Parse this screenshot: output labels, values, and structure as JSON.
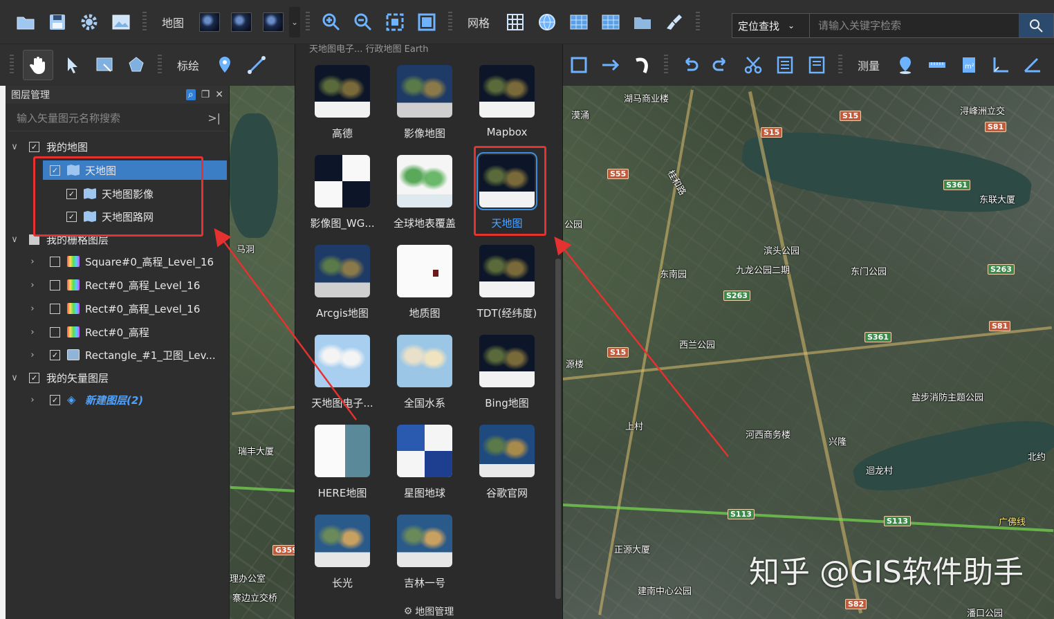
{
  "toolbar_top": {
    "map_label": "地图",
    "grid_label": "网格",
    "search_scope": "定位查找",
    "search_placeholder": "请输入关键字检索"
  },
  "toolbar_second": {
    "plot_label": "标绘",
    "measure_label": "测量"
  },
  "layer_panel": {
    "title": "图层管理",
    "search_placeholder": "输入矢量图元名称搜索",
    "rows": [
      {
        "label": "我的地图"
      },
      {
        "label": "天地图"
      },
      {
        "label": "天地图影像"
      },
      {
        "label": "天地图路网"
      },
      {
        "label": "我的栅格图层"
      },
      {
        "label": "Square#0_高程_Level_16"
      },
      {
        "label": "Rect#0_高程_Level_16"
      },
      {
        "label": "Rect#0_高程_Level_16"
      },
      {
        "label": "Rect#0_高程"
      },
      {
        "label": "Rectangle_#1_卫图_Lev..."
      },
      {
        "label": "我的矢量图层"
      },
      {
        "label": "新建图层(2)"
      }
    ]
  },
  "basemap_panel": {
    "cut_text": "天地图电子...      行政地图       Earth",
    "items": [
      {
        "name": "高德"
      },
      {
        "name": "影像地图"
      },
      {
        "name": "Mapbox"
      },
      {
        "name": "影像图_WG..."
      },
      {
        "name": "全球地表覆盖"
      },
      {
        "name": "天地图"
      },
      {
        "name": "Arcgis地图"
      },
      {
        "name": "地质图"
      },
      {
        "name": "TDT(经纬度)"
      },
      {
        "name": "天地图电子..."
      },
      {
        "name": "全国水系"
      },
      {
        "name": "Bing地图"
      },
      {
        "name": "HERE地图"
      },
      {
        "name": "星图地球"
      },
      {
        "name": "谷歌官网"
      },
      {
        "name": "长光"
      },
      {
        "name": "吉林一号"
      }
    ],
    "selected": "天地图",
    "footer": "地图管理"
  },
  "map": {
    "labels": [
      "湖马商业楼",
      "漠涌",
      "浔峰洲立交",
      "东联大厦",
      "马洞",
      "公园",
      "滨头公园",
      "九龙公园二期",
      "东南园",
      "东门公园",
      "桂和路",
      "西兰公园",
      "源楼",
      "上村",
      "河西商务楼",
      "兴隆",
      "北约",
      "瑞丰大厦",
      "迴龙村",
      "正源大厦",
      "建南中心公园",
      "理办公室",
      "寨边立交桥",
      "盐步消防主题公园",
      "广佛线",
      "潘口公园"
    ],
    "roads": [
      "S15",
      "S15",
      "S81",
      "S55",
      "S361",
      "S263",
      "S263",
      "S361",
      "S81",
      "S15",
      "G359",
      "S113",
      "S113",
      "S82"
    ],
    "watermark": "知乎 @GIS软件助手"
  },
  "colors": {
    "accent": "#3b7ec5",
    "annotation": "#e5312f",
    "panel_bg": "#2e2e2e",
    "toolbar_bg": "#303030"
  }
}
